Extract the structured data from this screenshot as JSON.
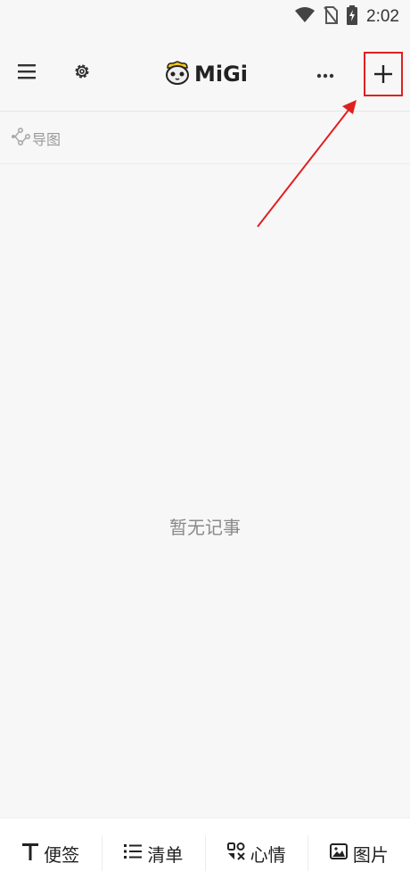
{
  "status_bar": {
    "time": "2:02",
    "icons": [
      "wifi-icon",
      "no-sim-icon",
      "battery-charging-icon"
    ]
  },
  "header": {
    "brand": "MiGi",
    "menu_icon": "menu-icon",
    "settings_icon": "gear-icon",
    "more_icon": "more-horizontal-icon",
    "add_icon": "plus-icon"
  },
  "mindmap": {
    "label": "导图",
    "icon": "mindmap-icon"
  },
  "main": {
    "empty_text": "暂无记事"
  },
  "bottom_tabs": [
    {
      "label": "便签",
      "icon": "text-t-icon"
    },
    {
      "label": "清单",
      "icon": "list-icon"
    },
    {
      "label": "心情",
      "icon": "mood-icon"
    },
    {
      "label": "图片",
      "icon": "image-icon"
    }
  ],
  "colors": {
    "annotation": "#e02020",
    "background": "#f7f7f7"
  }
}
